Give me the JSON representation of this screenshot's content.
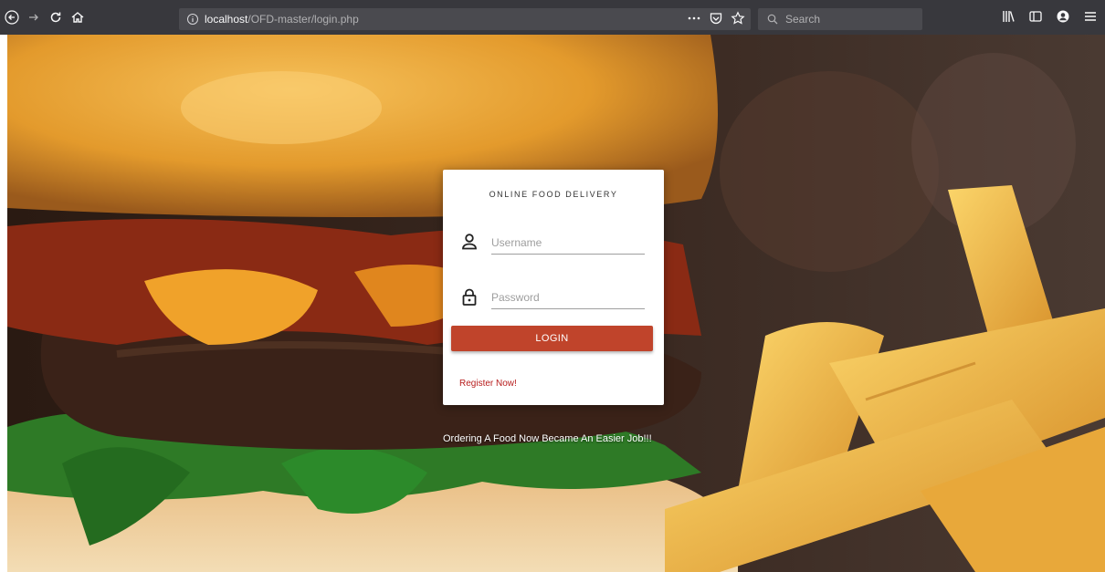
{
  "browser": {
    "url_host": "localhost",
    "url_path": "/OFD-master/login.php",
    "search_placeholder": "Search"
  },
  "login": {
    "title": "ONLINE FOOD DELIVERY",
    "username_placeholder": "Username",
    "password_placeholder": "Password",
    "login_label": "LOGIN",
    "register_label": "Register Now!"
  },
  "hero": {
    "tagline": "Ordering A Food Now Became An Easier Job!!!"
  },
  "colors": {
    "toolbar": "#38383d",
    "button": "#c0442b",
    "link": "#b71c1c"
  },
  "icons": [
    "back-icon",
    "forward-icon",
    "reload-icon",
    "home-icon",
    "info-icon",
    "more-icon",
    "pocket-icon",
    "bookmark-icon",
    "search-icon",
    "library-icon",
    "sidebar-icon",
    "account-icon",
    "menu-icon",
    "user-icon",
    "lock-icon"
  ]
}
